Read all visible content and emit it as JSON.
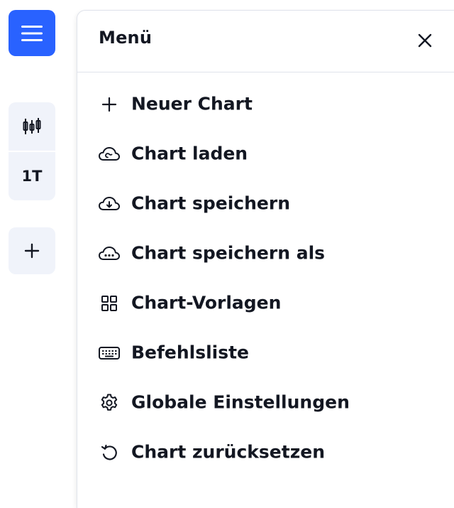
{
  "left_toolbar": {
    "menu_button_icon": "hamburger-icon",
    "chart_type_icon": "candlestick-icon",
    "interval_label": "1T",
    "add_icon": "plus-icon"
  },
  "menu": {
    "title": "Menü",
    "close_icon": "close-icon",
    "items": [
      {
        "label": "Neuer Chart",
        "icon": "plus-icon"
      },
      {
        "label": "Chart laden",
        "icon": "cloud-icon"
      },
      {
        "label": "Chart speichern",
        "icon": "cloud-save-icon"
      },
      {
        "label": "Chart speichern als",
        "icon": "cloud-save-as-icon"
      },
      {
        "label": "Chart-Vorlagen",
        "icon": "grid-icon"
      },
      {
        "label": "Befehlsliste",
        "icon": "keyboard-icon"
      },
      {
        "label": "Globale Einstellungen",
        "icon": "gear-icon"
      },
      {
        "label": "Chart zurücksetzen",
        "icon": "reset-icon"
      }
    ]
  },
  "colors": {
    "accent": "#2962ff",
    "tool_bg": "#f0f3fa",
    "text": "#131722",
    "border": "#e0e3eb"
  }
}
